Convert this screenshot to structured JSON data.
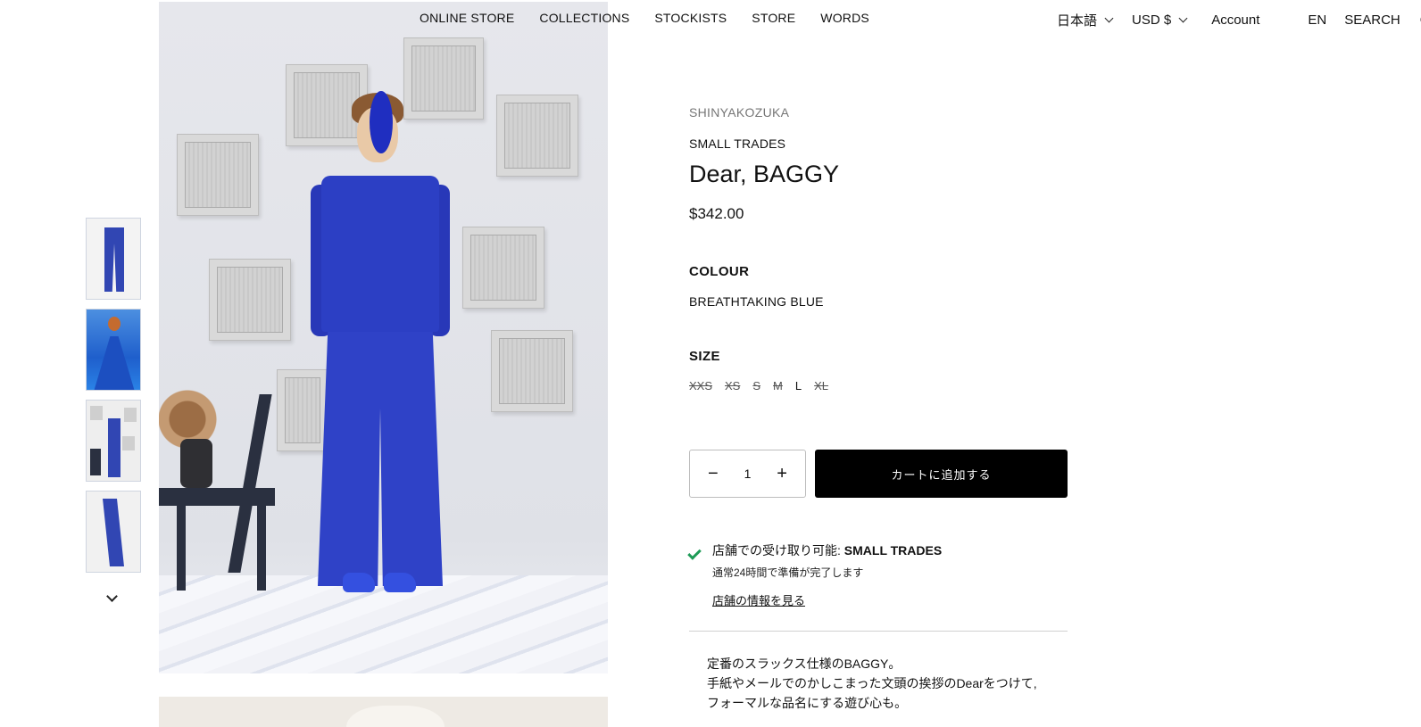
{
  "header": {
    "nav": [
      "ONLINE STORE",
      "COLLECTIONS",
      "STOCKISTS",
      "STORE",
      "WORDS"
    ],
    "language": "日本語",
    "currency": "USD $",
    "account": "Account",
    "locale": "EN",
    "search": "SEARCH",
    "edge_fragment": "C"
  },
  "product": {
    "vendor": "SHINYAKOZUKA",
    "shop": "SMALL TRADES",
    "title": "Dear, BAGGY",
    "price": "$342.00",
    "colour_label": "COLOUR",
    "colour_value": "BREATHTAKING BLUE",
    "size_label": "SIZE",
    "sizes": [
      {
        "label": "XXS",
        "available": false
      },
      {
        "label": "XS",
        "available": false
      },
      {
        "label": "S",
        "available": false
      },
      {
        "label": "M",
        "available": false
      },
      {
        "label": "L",
        "available": true
      },
      {
        "label": "XL",
        "available": false
      }
    ],
    "quantity": "1",
    "qty_minus": "−",
    "qty_plus": "+",
    "add_to_cart": "カートに追加する"
  },
  "pickup": {
    "prefix": "店舗での受け取り可能: ",
    "store": "SMALL TRADES",
    "sub": "通常24時間で準備が完了します",
    "link": "店舗の情報を見る"
  },
  "description": [
    "定番のスラックス仕様のBAGGY。",
    "手紙やメールでのかしこまった文頭の挨拶のDearをつけて,",
    "フォーマルな品名にする遊び心も。"
  ],
  "colors": {
    "accent_blue": "#2f42c7",
    "check_green": "#1e9b57",
    "button_black": "#000000"
  }
}
